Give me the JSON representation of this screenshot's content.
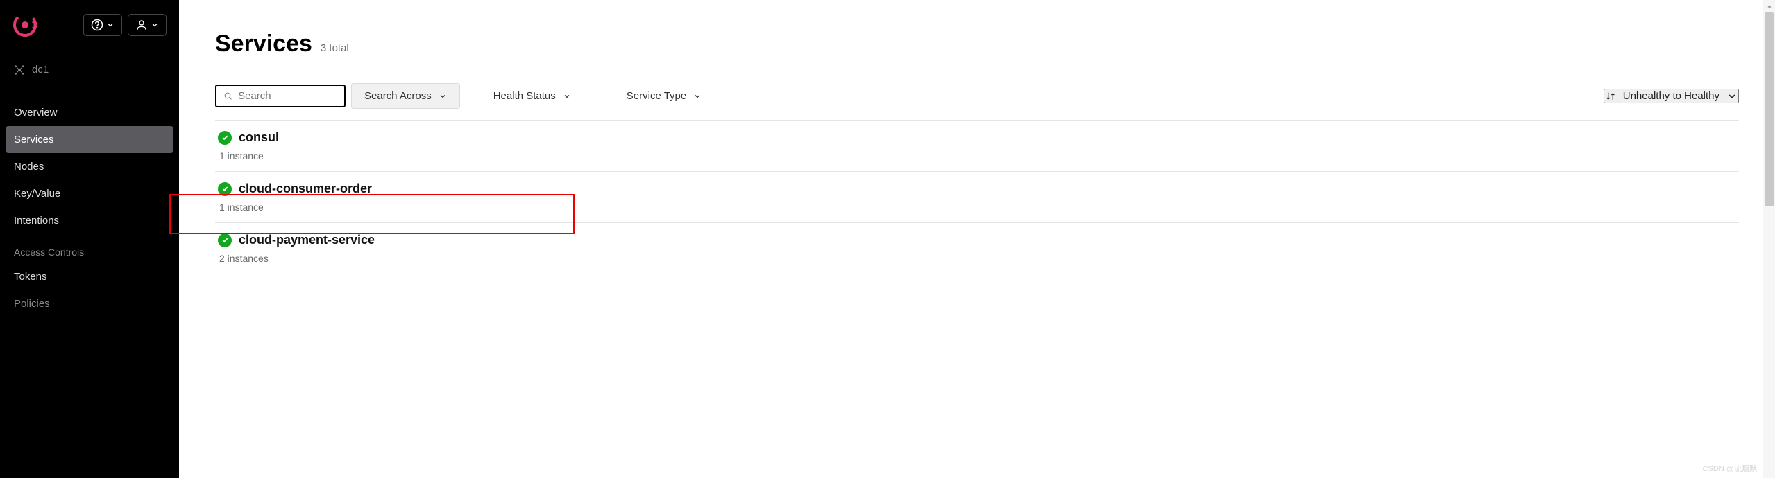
{
  "datacenter": "dc1",
  "nav": {
    "items": [
      "Overview",
      "Services",
      "Nodes",
      "Key/Value",
      "Intentions"
    ],
    "active_index": 1,
    "section_label": "Access Controls",
    "ac_items": [
      "Tokens",
      "Policies"
    ]
  },
  "page": {
    "title": "Services",
    "subtitle": "3 total"
  },
  "toolbar": {
    "search_placeholder": "Search",
    "search_across": "Search Across",
    "health_status": "Health Status",
    "service_type": "Service Type",
    "sort_label": "Unhealthy to Healthy"
  },
  "services": [
    {
      "name": "consul",
      "instances": "1 instance",
      "status": "healthy"
    },
    {
      "name": "cloud-consumer-order",
      "instances": "1 instance",
      "status": "healthy"
    },
    {
      "name": "cloud-payment-service",
      "instances": "2 instances",
      "status": "healthy"
    }
  ],
  "watermark": "CSDN @流烟默"
}
